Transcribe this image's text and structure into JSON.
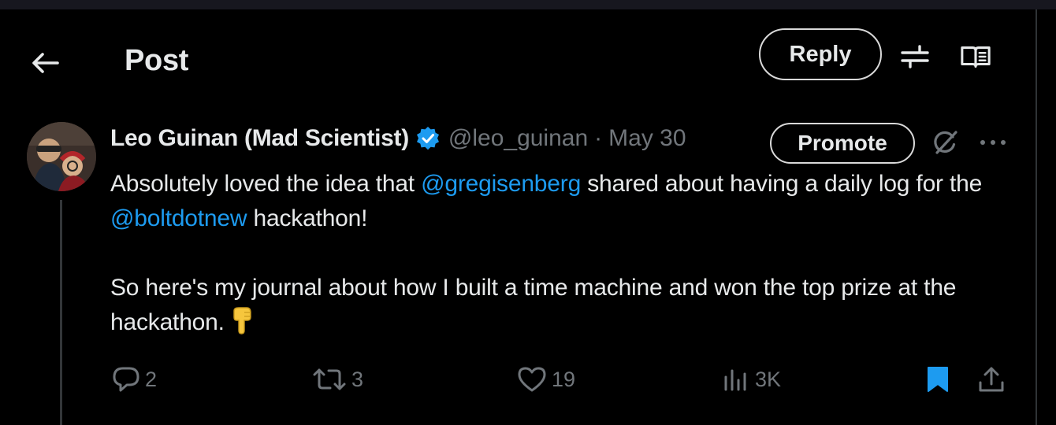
{
  "header": {
    "back_icon": "arrow-left-icon",
    "title": "Post",
    "reply_label": "Reply",
    "filter_icon": "sliders-icon",
    "reader_icon": "reader-mode-icon"
  },
  "post": {
    "author_name": "Leo Guinan (Mad Scientist)",
    "verified": true,
    "handle": "@leo_guinan",
    "separator": "·",
    "date": "May 30",
    "promote_label": "Promote",
    "text": {
      "p1_before": "Absolutely loved the idea that ",
      "p1_mention1": "@gregisenberg",
      "p1_middle": " shared about having a daily log for the ",
      "p1_mention2": "@boltdotnew",
      "p1_after": " hackathon!",
      "p2": "So here's my journal about how I built a time machine and won the top prize at the hackathon.",
      "emoji": "👇"
    },
    "stats": {
      "replies": "2",
      "reposts": "3",
      "likes": "19",
      "views": "3K"
    }
  },
  "colors": {
    "background": "#000000",
    "text": "#e7e9ea",
    "muted": "#71767b",
    "link": "#1d9bf0",
    "verified": "#1d9bf0",
    "bookmark_active": "#1d9bf0"
  }
}
